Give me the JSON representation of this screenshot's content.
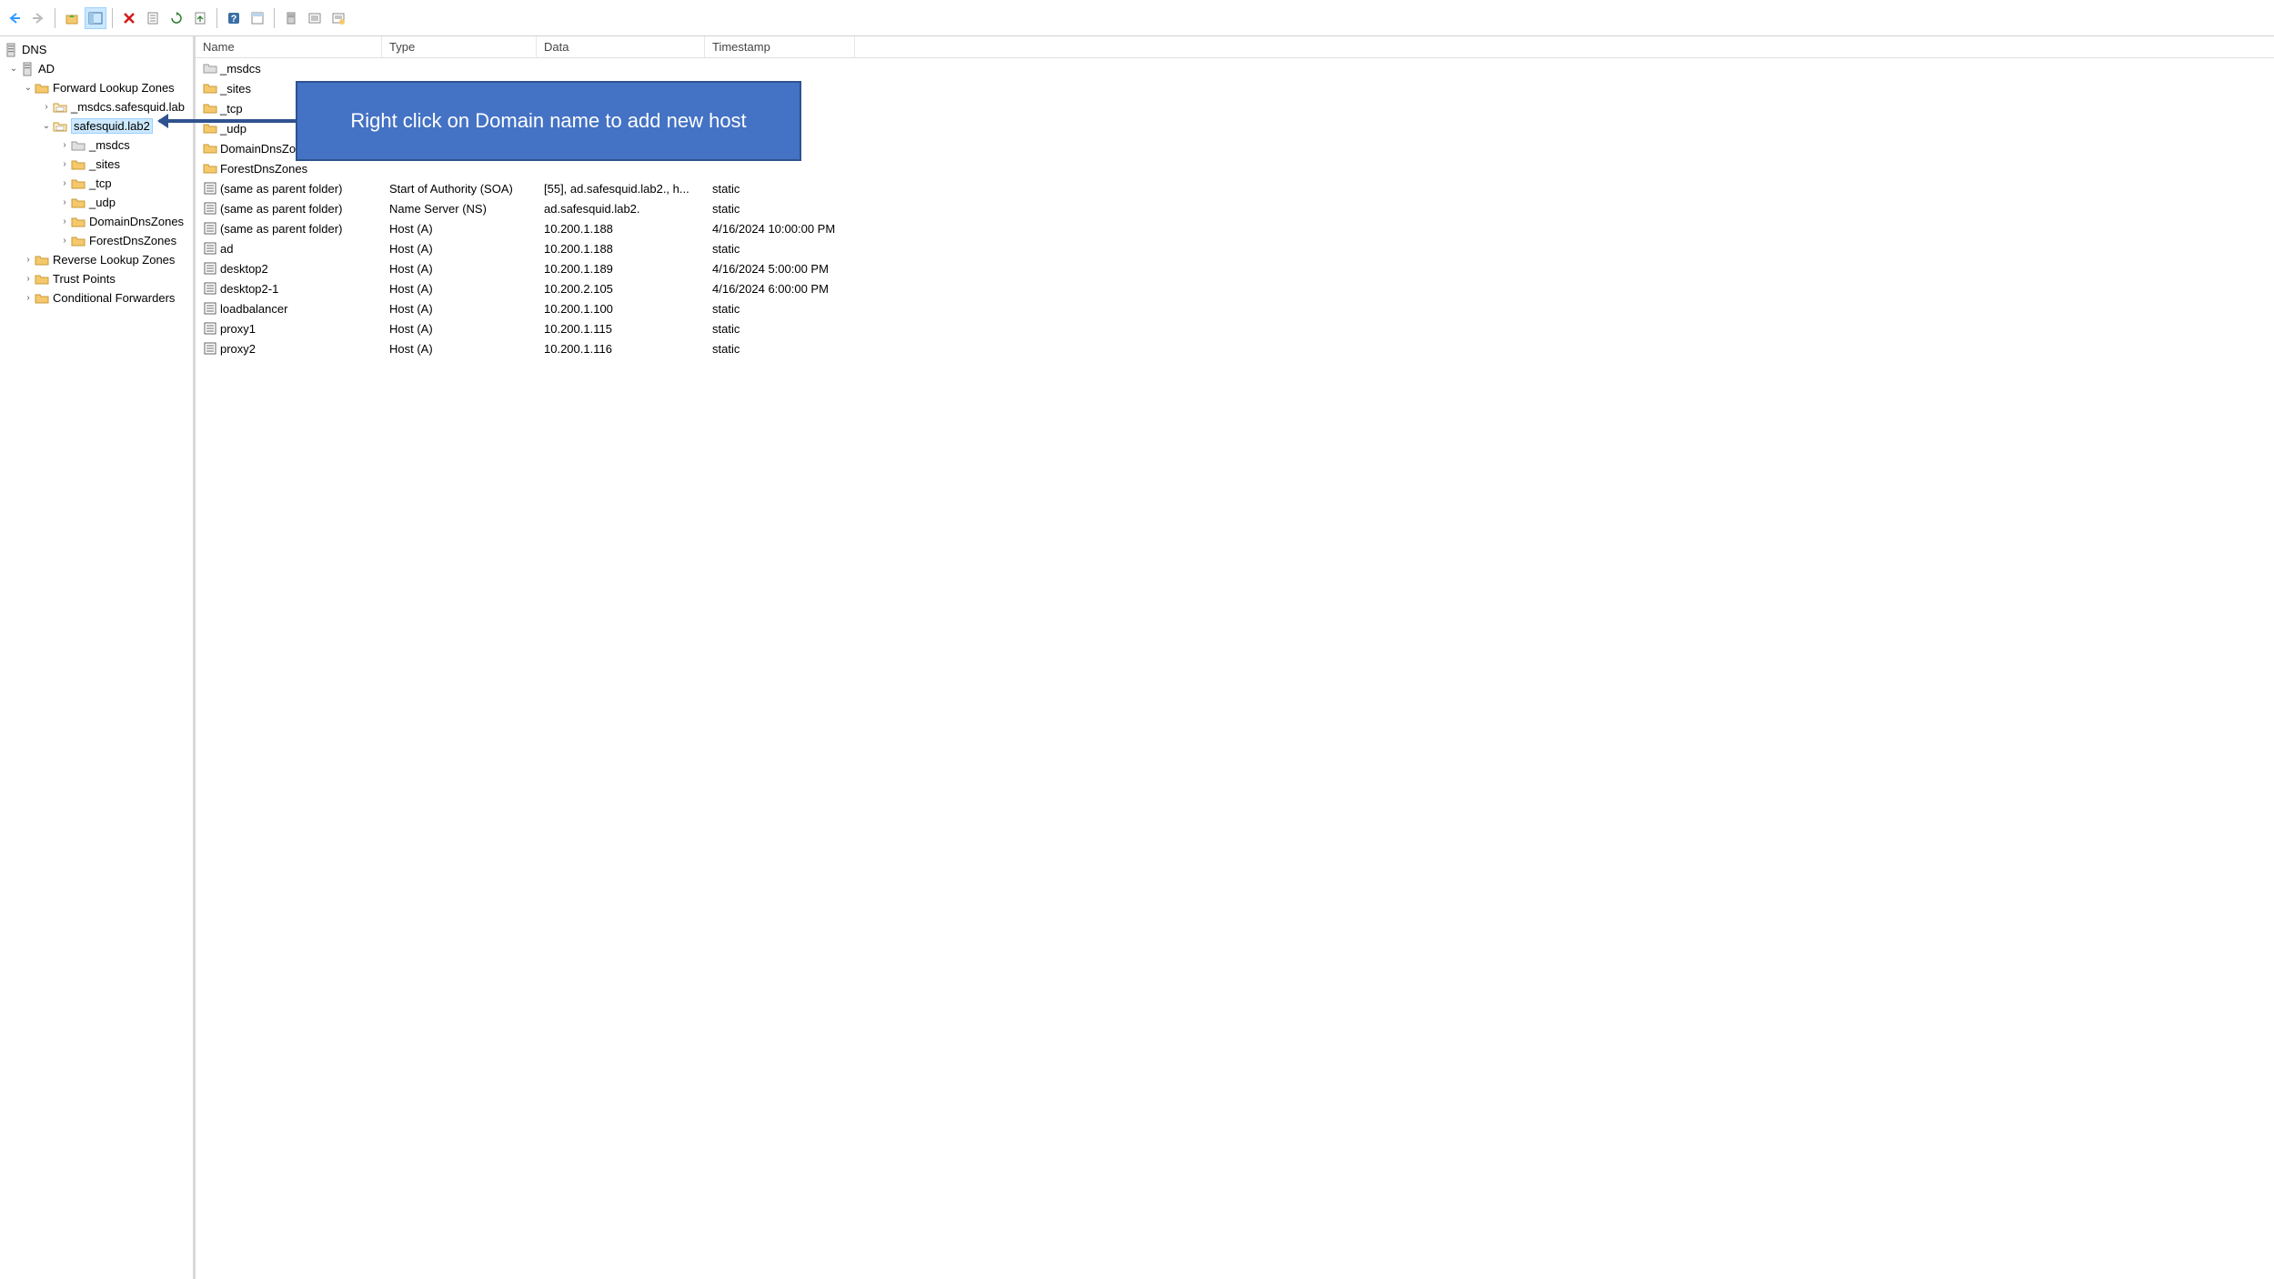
{
  "toolbar": {
    "back": "back",
    "forward": "forward"
  },
  "tree": {
    "root": "DNS",
    "server": "AD",
    "flz": "Forward Lookup Zones",
    "zone1": "_msdcs.safesquid.lab",
    "zone2": "safesquid.lab2",
    "sub_msdcs": "_msdcs",
    "sub_sites": "_sites",
    "sub_tcp": "_tcp",
    "sub_udp": "_udp",
    "sub_domaindns": "DomainDnsZones",
    "sub_forestdns": "ForestDnsZones",
    "rlz": "Reverse Lookup Zones",
    "trust": "Trust Points",
    "conditional": "Conditional Forwarders"
  },
  "list": {
    "headers": {
      "name": "Name",
      "type": "Type",
      "data": "Data",
      "timestamp": "Timestamp"
    },
    "rows": [
      {
        "name": "_msdcs",
        "type": "",
        "data": "",
        "ts": "",
        "icon": "folder-gray"
      },
      {
        "name": "_sites",
        "type": "",
        "data": "",
        "ts": "",
        "icon": "folder"
      },
      {
        "name": "_tcp",
        "type": "",
        "data": "",
        "ts": "",
        "icon": "folder"
      },
      {
        "name": "_udp",
        "type": "",
        "data": "",
        "ts": "",
        "icon": "folder"
      },
      {
        "name": "DomainDnsZones",
        "type": "",
        "data": "",
        "ts": "",
        "icon": "folder"
      },
      {
        "name": "ForestDnsZones",
        "type": "",
        "data": "",
        "ts": "",
        "icon": "folder"
      },
      {
        "name": "(same as parent folder)",
        "type": "Start of Authority (SOA)",
        "data": "[55], ad.safesquid.lab2., h...",
        "ts": "static",
        "icon": "record"
      },
      {
        "name": "(same as parent folder)",
        "type": "Name Server (NS)",
        "data": "ad.safesquid.lab2.",
        "ts": "static",
        "icon": "record"
      },
      {
        "name": "(same as parent folder)",
        "type": "Host (A)",
        "data": "10.200.1.188",
        "ts": "4/16/2024 10:00:00 PM",
        "icon": "record"
      },
      {
        "name": "ad",
        "type": "Host (A)",
        "data": "10.200.1.188",
        "ts": "static",
        "icon": "record"
      },
      {
        "name": "desktop2",
        "type": "Host (A)",
        "data": "10.200.1.189",
        "ts": "4/16/2024 5:00:00 PM",
        "icon": "record"
      },
      {
        "name": "desktop2-1",
        "type": "Host (A)",
        "data": "10.200.2.105",
        "ts": "4/16/2024 6:00:00 PM",
        "icon": "record"
      },
      {
        "name": "loadbalancer",
        "type": "Host (A)",
        "data": "10.200.1.100",
        "ts": "static",
        "icon": "record"
      },
      {
        "name": "proxy1",
        "type": "Host (A)",
        "data": "10.200.1.115",
        "ts": "static",
        "icon": "record"
      },
      {
        "name": "proxy2",
        "type": "Host (A)",
        "data": "10.200.1.116",
        "ts": "static",
        "icon": "record"
      }
    ]
  },
  "callout": {
    "text": "Right click on Domain name to add new host"
  }
}
